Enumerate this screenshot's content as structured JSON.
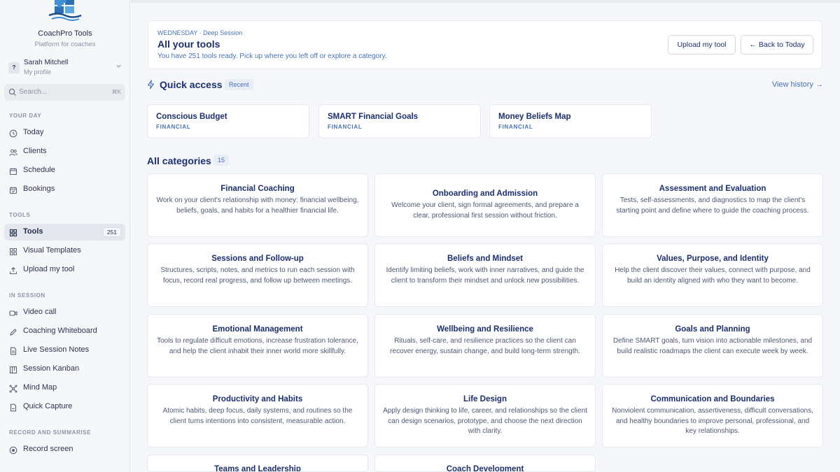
{
  "brand": {
    "name": "CoachPro Tools",
    "tagline": "Platform for coaches"
  },
  "profile": {
    "initial": "?",
    "name": "Sarah Mitchell",
    "subtitle": "My profile"
  },
  "search": {
    "placeholder": "Search...",
    "shortcut": "⌘K"
  },
  "sidebar": {
    "sections": {
      "your_day": "YOUR DAY",
      "tools": "TOOLS",
      "in_session": "IN SESSION",
      "record": "RECORD AND SUMMARISE"
    },
    "items": [
      {
        "label": "Today",
        "icon": "clock-icon"
      },
      {
        "label": "Clients",
        "icon": "users-icon"
      },
      {
        "label": "Schedule",
        "icon": "calendar-icon"
      },
      {
        "label": "Bookings",
        "icon": "calendar-check-icon"
      },
      {
        "label": "Tools",
        "icon": "grid-icon",
        "badge": "251",
        "active": true
      },
      {
        "label": "Visual Templates",
        "icon": "template-icon"
      },
      {
        "label": "Upload my tool",
        "icon": "upload-icon"
      },
      {
        "label": "Video call",
        "icon": "video-icon"
      },
      {
        "label": "Coaching Whiteboard",
        "icon": "pen-icon"
      },
      {
        "label": "Live Session Notes",
        "icon": "note-icon"
      },
      {
        "label": "Session Kanban",
        "icon": "kanban-icon"
      },
      {
        "label": "Mind Map",
        "icon": "mindmap-icon"
      },
      {
        "label": "Quick Capture",
        "icon": "capture-icon"
      },
      {
        "label": "Record screen",
        "icon": "record-icon"
      }
    ]
  },
  "header": {
    "eyebrow": "WEDNESDAY · Deep Session",
    "title": "All your tools",
    "subtitle": "You have 251 tools ready. Pick up where you left off or explore a category.",
    "upload_label": "Upload my tool",
    "back_label": "← Back to Today"
  },
  "quick_access": {
    "title": "Quick access",
    "chip": "Recent",
    "view_history": "View history →",
    "items": [
      {
        "name": "Conscious Budget",
        "tag": "FINANCIAL"
      },
      {
        "name": "SMART Financial Goals",
        "tag": "FINANCIAL"
      },
      {
        "name": "Money Beliefs Map",
        "tag": "FINANCIAL"
      }
    ]
  },
  "categories": {
    "title": "All categories",
    "count": "15",
    "items": [
      {
        "name": "Financial Coaching",
        "desc": "Work on your client's relationship with money: financial wellbeing, beliefs, goals, and habits for a healthier financial life."
      },
      {
        "name": "Onboarding and Admission",
        "desc": "Welcome your client, sign formal agreements, and prepare a clear, professional first session without friction."
      },
      {
        "name": "Assessment and Evaluation",
        "desc": "Tests, self-assessments, and diagnostics to map the client's starting point and define where to guide the coaching process."
      },
      {
        "name": "Sessions and Follow-up",
        "desc": "Structures, scripts, notes, and metrics to run each session with focus, record real progress, and follow up between meetings."
      },
      {
        "name": "Beliefs and Mindset",
        "desc": "Identify limiting beliefs, work with inner narratives, and guide the client to transform their mindset and unlock new possibilities."
      },
      {
        "name": "Values, Purpose, and Identity",
        "desc": "Help the client discover their values, connect with purpose, and build an identity aligned with who they want to become."
      },
      {
        "name": "Emotional Management",
        "desc": "Tools to regulate difficult emotions, increase frustration tolerance, and help the client inhabit their inner world more skillfully."
      },
      {
        "name": "Wellbeing and Resilience",
        "desc": "Rituals, self-care, and resilience practices so the client can recover energy, sustain change, and build long-term strength."
      },
      {
        "name": "Goals and Planning",
        "desc": "Define SMART goals, turn vision into actionable milestones, and build realistic roadmaps the client can execute week by week."
      },
      {
        "name": "Productivity and Habits",
        "desc": "Atomic habits, deep focus, daily systems, and routines so the client turns intentions into consistent, measurable action."
      },
      {
        "name": "Life Design",
        "desc": "Apply design thinking to life, career, and relationships so the client can design scenarios, prototype, and choose the next direction with clarity."
      },
      {
        "name": "Communication and Boundaries",
        "desc": "Nonviolent communication, assertiveness, difficult conversations, and healthy boundaries to improve personal, professional, and key relationships."
      },
      {
        "name": "Teams and Leadership",
        "desc": ""
      },
      {
        "name": "Coach Development",
        "desc": ""
      }
    ]
  }
}
